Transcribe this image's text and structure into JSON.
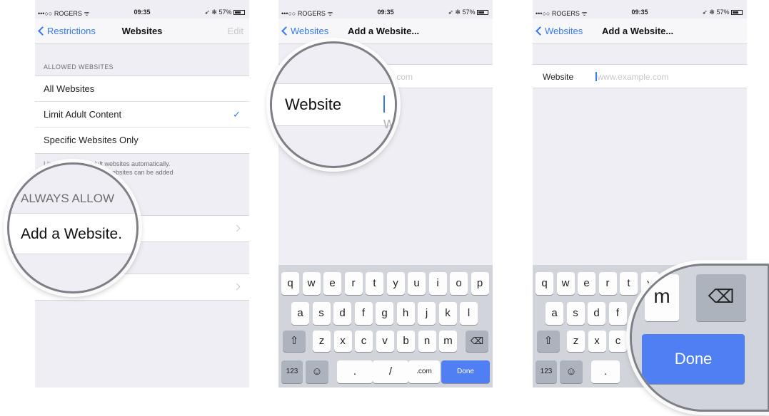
{
  "status": {
    "carrier": "•••○○ ROGERS ᯤ",
    "time": "09:35",
    "battery": "➶ ✻ 57%"
  },
  "panel1": {
    "nav": {
      "back": "Restrictions",
      "title": "Websites",
      "right": "Edit"
    },
    "allowed_header": "ALLOWED WEBSITES",
    "options": [
      {
        "label": "All Websites"
      },
      {
        "label": "Limit Adult Content",
        "checkmark": "✓"
      },
      {
        "label": "Specific Websites Only"
      }
    ],
    "footnote_line1": "Limi         many adult websites automatically.",
    "footnote_line2": "                 d restricted websites can be added",
    "never_allow_item": "            e...",
    "magnifier": {
      "header": "ALWAYS ALLOW",
      "item": "Add a Website."
    }
  },
  "panel2": {
    "nav": {
      "back": "Websites",
      "title": "Add a Website..."
    },
    "partial_placeholder": "ple.com",
    "magnifier": {
      "label": "Website",
      "typed": "w"
    },
    "keyboard": {
      "row1": [
        "q",
        "w",
        "e",
        "r",
        "t",
        "y",
        "u",
        "i",
        "o",
        "p"
      ],
      "row2": [
        "a",
        "s",
        "d",
        "f",
        "g",
        "h",
        "j",
        "k",
        "l"
      ],
      "row3": [
        "z",
        "x",
        "c",
        "v",
        "b",
        "n",
        "m"
      ],
      "shift_glyph": "⇧",
      "delete_glyph": "⌫",
      "numbers": "123",
      "emoji": "☺",
      "dot": ".",
      "slash": "/",
      "dotcom": ".com",
      "done": "Done"
    }
  },
  "panel3": {
    "nav": {
      "back": "Websites",
      "title": "Add a Website..."
    },
    "field_label": "Website",
    "placeholder": "www.example.com",
    "keyboard": {
      "row1": [
        "q",
        "w",
        "e",
        "r",
        "t",
        "y"
      ],
      "row2": [
        "a",
        "s",
        "d",
        "f"
      ],
      "row3": [
        "z",
        "x",
        "c"
      ],
      "shift_glyph": "⇧",
      "numbers": "123",
      "emoji": "☺",
      "dot": "."
    },
    "magnifier": {
      "key": "m",
      "delete_glyph": "⌫",
      "done": "Done"
    }
  },
  "colors": {
    "accent": "#3478f6",
    "done_key": "#4f7ff2",
    "keyboard_bg": "#d1d5db",
    "grouped_bg": "#eeeef4"
  }
}
